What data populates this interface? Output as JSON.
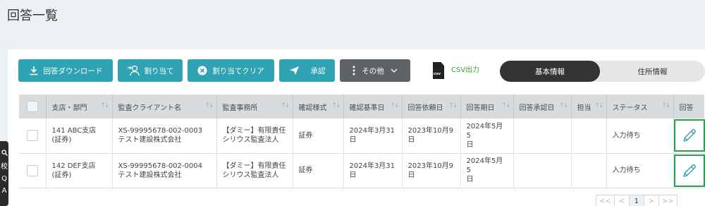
{
  "page": {
    "title": "回答一覧"
  },
  "toolbar": {
    "download": "回答ダウンロード",
    "assign": "割り当て",
    "clear_assign": "割り当てクリア",
    "approve": "承認",
    "other": "その他",
    "csv_icon_text": "csv",
    "csv_output": "CSV出力",
    "basic_info": "基本情報",
    "address_info": "住所情報"
  },
  "table": {
    "headers": [
      "支店・部門",
      "監査クライアント名",
      "監査事務所",
      "確認様式",
      "確認基準日",
      "回答依頼日",
      "回答期日",
      "回答承認日",
      "担当",
      "ステータス",
      "回答"
    ],
    "rows": [
      {
        "branch": "141 ABC支店",
        "dept": "(証券)",
        "client_code": "XS-99995678-002-0003",
        "client_name": "テスト建設株式会社",
        "firm_line1": "【ダミー】有限責任",
        "firm_line2": "シリウス監査法人",
        "form": "証券",
        "base_date_1": "2024年3月31",
        "base_date_2": "日",
        "request_date_1": "2023年10月9",
        "request_date_2": "日",
        "due_date_1": "2024年5月5",
        "due_date_2": "日",
        "approval_date": "",
        "assignee": "",
        "status": "入力待ち"
      },
      {
        "branch": "142 DEF支店",
        "dept": "(証券)",
        "client_code": "XS-99995678-002-0004",
        "client_name": "テスト建設株式会社",
        "firm_line1": "【ダミー】有限責任",
        "firm_line2": "シリウス監査法人",
        "form": "証券",
        "base_date_1": "2024年3月31",
        "base_date_2": "日",
        "request_date_1": "2023年10月9",
        "request_date_2": "日",
        "due_date_1": "2024年5月5",
        "due_date_2": "日",
        "approval_date": "",
        "assignee": "",
        "status": "入力待ち"
      }
    ]
  },
  "pagination": {
    "first": "<<",
    "prev": "<",
    "current": "1",
    "next": ">",
    "last": ">>"
  },
  "side_tab": {
    "text_1": "校",
    "text_2": "Q",
    "text_3": "A"
  },
  "colors": {
    "primary": "#2fa3b3",
    "dark": "#5e6266",
    "csv": "#3aa63a",
    "highlight": "#26a24a"
  }
}
